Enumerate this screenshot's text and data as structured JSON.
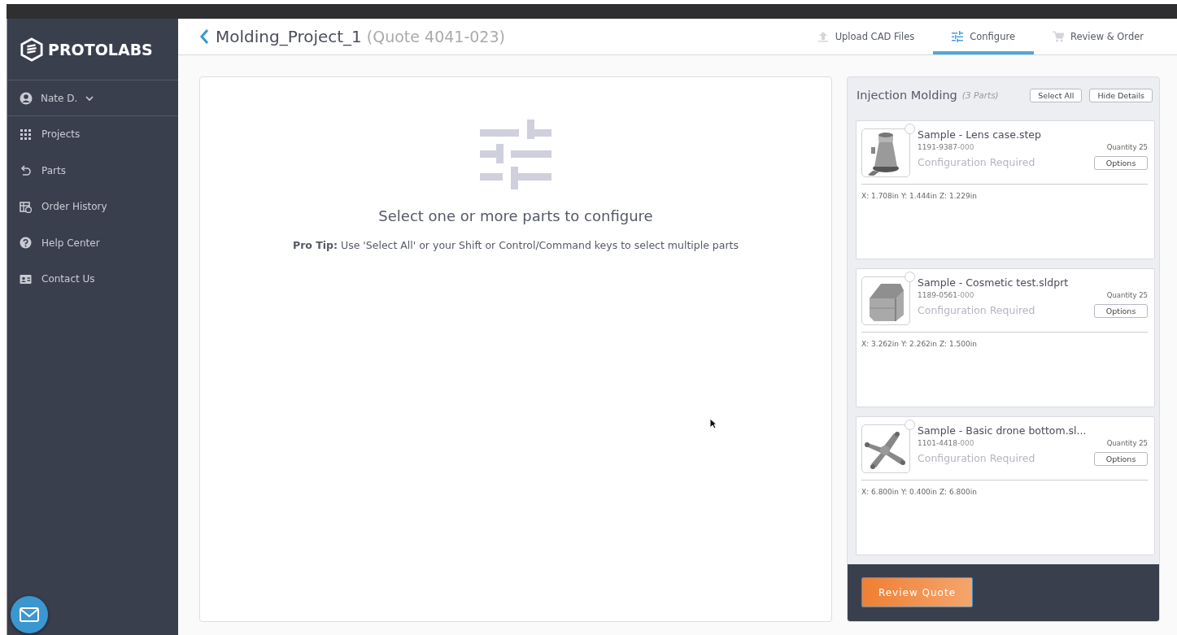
{
  "sidebar": {
    "logo": "PROTOLABS",
    "user": "Nate D.",
    "items": [
      {
        "label": "Projects",
        "selected": false
      },
      {
        "label": "Parts",
        "selected": false
      },
      {
        "label": "Order History",
        "selected": false
      },
      {
        "label": "Help Center",
        "selected": false
      },
      {
        "label": "Contact Us",
        "selected": false
      }
    ]
  },
  "header": {
    "title": "Molding_Project_1",
    "subtitle": "(Quote 4041-023)",
    "tabs": [
      {
        "label": "Upload CAD Files",
        "selected": false
      },
      {
        "label": "Configure",
        "selected": true
      },
      {
        "label": "Review & Order",
        "selected": false
      }
    ]
  },
  "main": {
    "heading": "Select one or more parts to configure",
    "tip_label": "Pro Tip:",
    "tip": "Use 'Select All' or your Shift or Control/Command keys to select multiple parts"
  },
  "parts_panel": {
    "title": "Injection Molding",
    "count": "(3 Parts)",
    "buttons": [
      "Select All",
      "Hide Details"
    ],
    "parts": [
      {
        "name": "Sample - Lens case.step",
        "number": "1191-9387",
        "suffix": "-000",
        "quantity": "Quantity 25",
        "status": "Configuration Required",
        "button": "Options",
        "dims": "X: 1.708in Y: 1.444in Z: 1.229in",
        "selected": false
      },
      {
        "name": "Sample - Cosmetic test.sldprt",
        "number": "1189-0561",
        "suffix": "-000",
        "quantity": "Quantity 25",
        "status": "Configuration Required",
        "button": "Options",
        "dims": "X: 3.262in Y: 2.262in Z: 1.500in",
        "selected": false
      },
      {
        "name": "Sample - Basic drone bottom.sl...",
        "number": "1101-4418",
        "suffix": "-000",
        "quantity": "Quantity 25",
        "status": "Configuration Required",
        "button": "Options",
        "dims": "X: 6.800in Y: 0.400in Z: 6.800in",
        "selected": false
      }
    ],
    "review_button": "Review Quote"
  }
}
